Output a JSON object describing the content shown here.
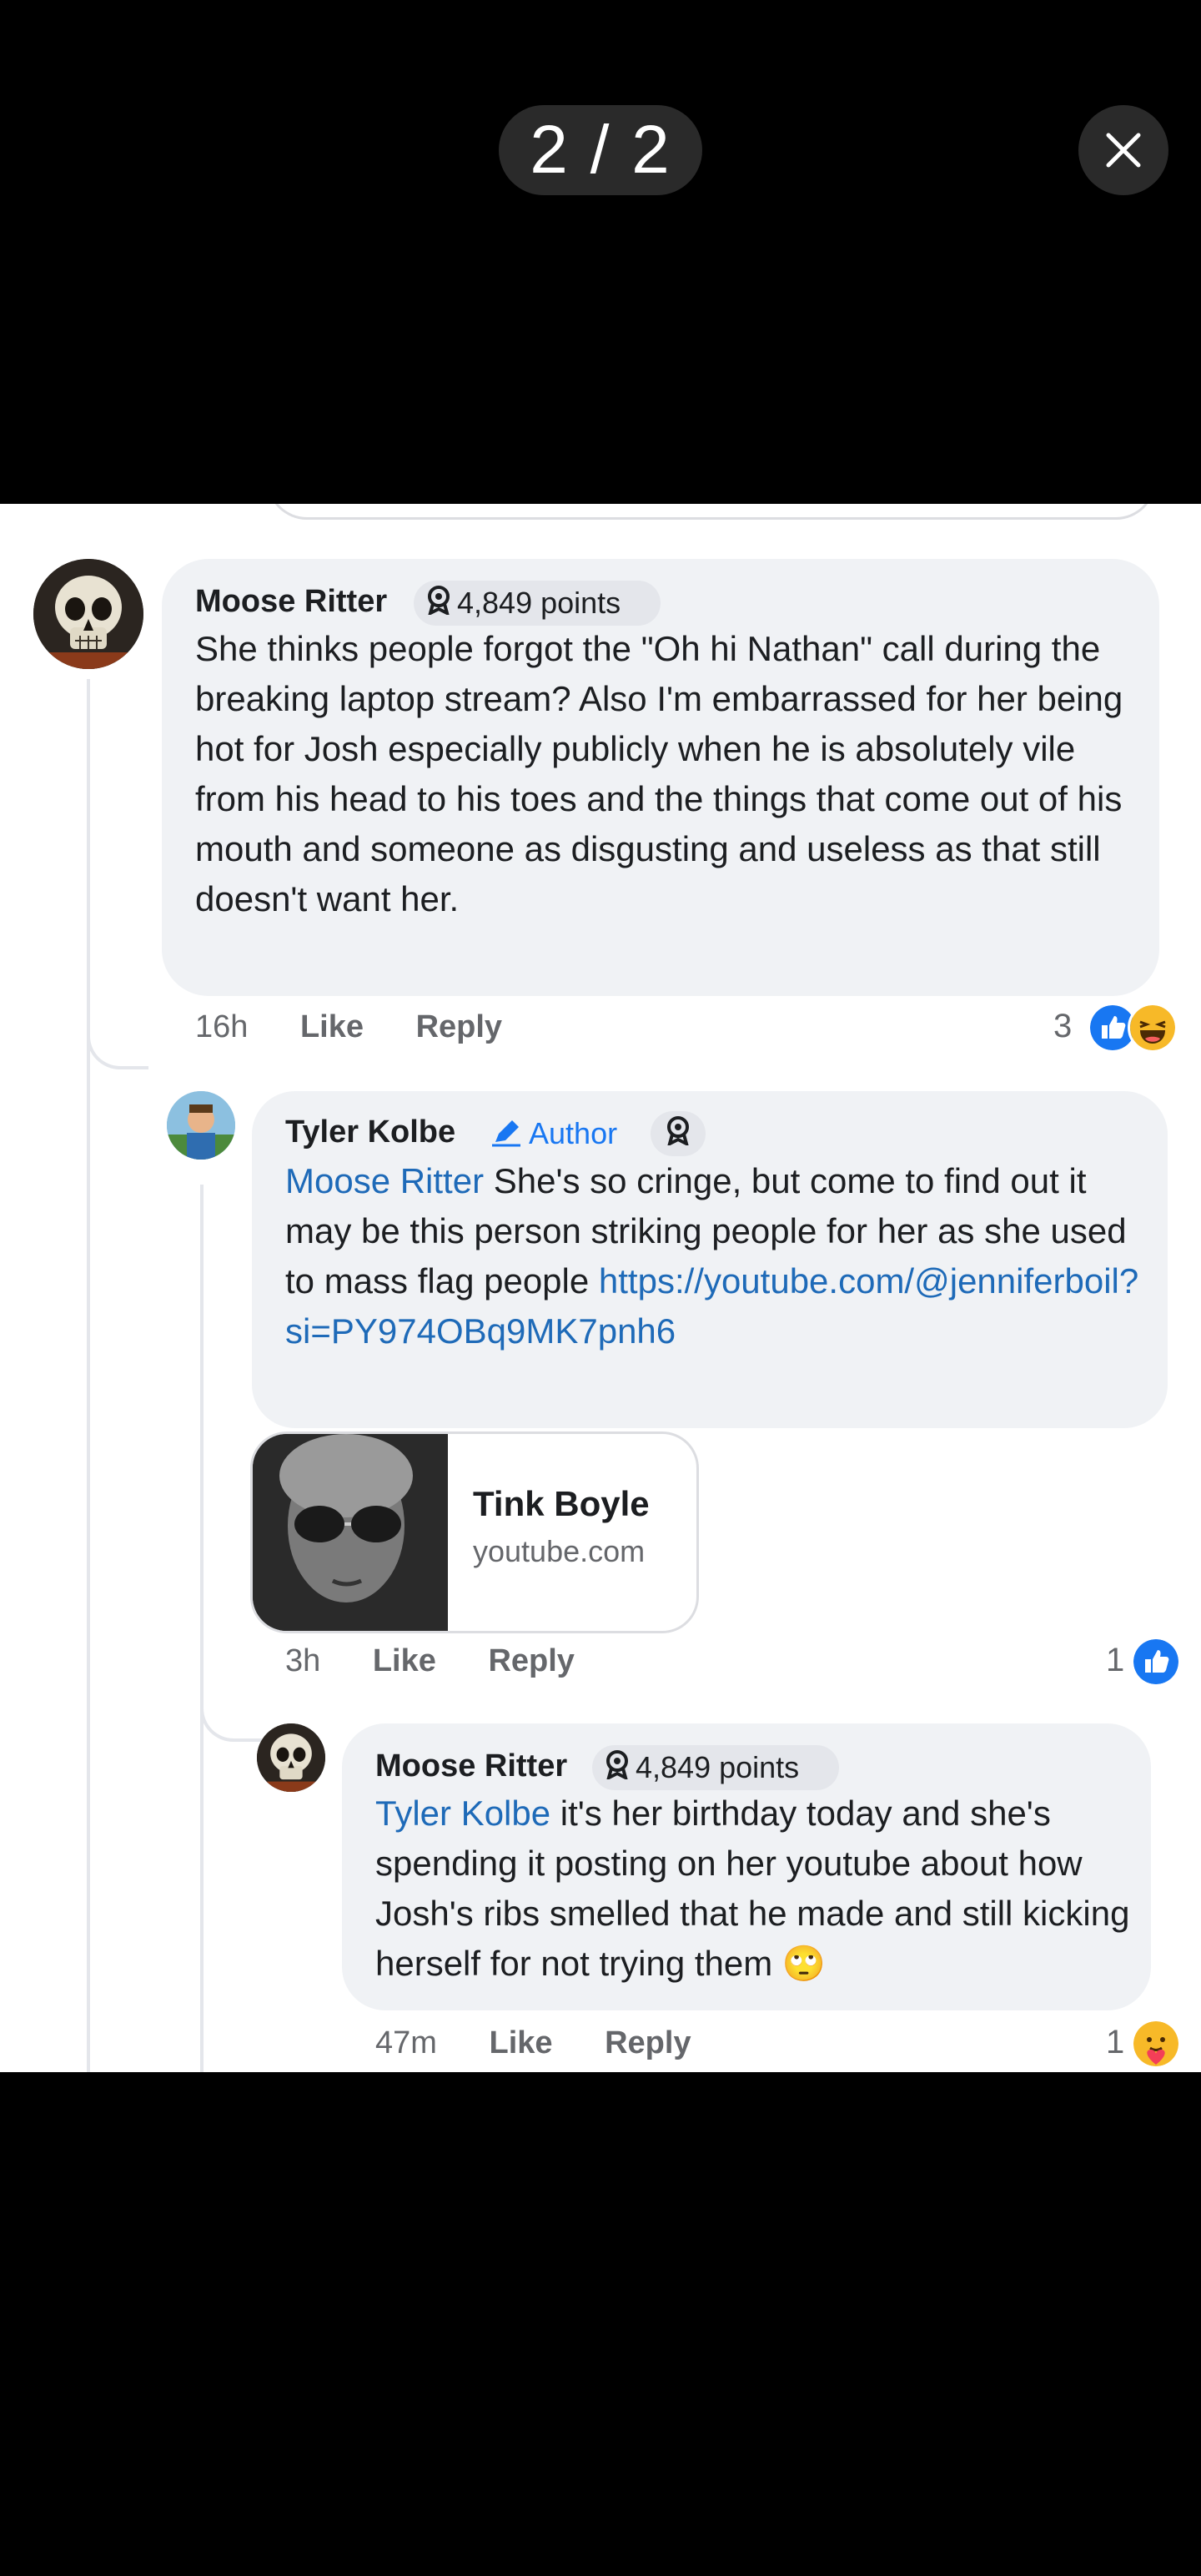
{
  "viewer": {
    "counter": "2 / 2",
    "close_icon": "close-icon"
  },
  "comments": [
    {
      "name": "Moose Ritter",
      "badge": "4,849 points",
      "text": "She thinks people forgot  the  \"Oh hi Nathan\" call during the breaking laptop stream? Also I'm embarrassed for her being hot for Josh especially publicly  when he is absolutely vile from his head to his toes and the things that come out of his mouth and someone as disgusting and useless as that still doesn't want her.",
      "time": "16h",
      "like": "Like",
      "reply": "Reply",
      "reaction_count": "3",
      "reactions": [
        "like-icon",
        "haha-icon"
      ]
    },
    {
      "name": "Tyler Kolbe",
      "author_label": "Author",
      "mention": "Moose Ritter",
      "text": " She's so cringe, but come to find out it may be this person striking people for her as she used to mass flag people ",
      "link": "https://youtube.com/@jenniferboil?si=PY974OBq9MK7pnh6",
      "card": {
        "title": "Tink Boyle",
        "domain": "youtube.com"
      },
      "time": "3h",
      "like": "Like",
      "reply": "Reply",
      "reaction_count": "1",
      "reactions": [
        "like-icon"
      ]
    },
    {
      "name": "Moose Ritter",
      "badge": "4,849 points",
      "mention": "Tyler Kolbe",
      "text": " it's her birthday today and she's spending it posting on her youtube about how Josh's ribs smelled that he made and still kicking herself for not trying them 🙄",
      "time": "47m",
      "like": "Like",
      "reply": "Reply",
      "reaction_count": "1",
      "reactions": [
        "care-icon"
      ]
    }
  ],
  "colors": {
    "background": "#000000",
    "panel": "#ffffff",
    "bubble": "#f0f2f5",
    "link": "#1e6ab8",
    "like_blue": "#1877f2"
  }
}
